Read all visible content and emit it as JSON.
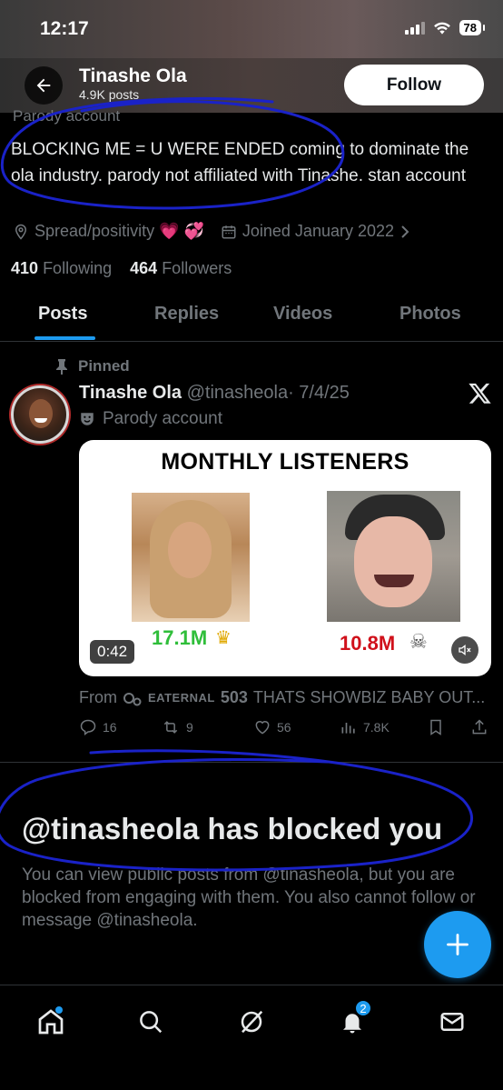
{
  "status_bar": {
    "time": "12:17",
    "battery": "78"
  },
  "header": {
    "name": "Tinashe Ola",
    "post_count": "4.9K posts",
    "follow_label": "Follow"
  },
  "profile": {
    "cut_label": "Parody account",
    "bio": "BLOCKING ME = U WERE ENDED coming to dominate the ola industry. parody not affiliated with Tinashe. stan account",
    "location": "Spread/positivity 💗 💞",
    "joined": "Joined January 2022",
    "following_count": "410",
    "following_label": "Following",
    "followers_count": "464",
    "followers_label": "Followers"
  },
  "tabs": [
    {
      "label": "Posts",
      "active": true
    },
    {
      "label": "Replies",
      "active": false
    },
    {
      "label": "Videos",
      "active": false
    },
    {
      "label": "Photos",
      "active": false
    }
  ],
  "post": {
    "pinned_label": "Pinned",
    "author": "Tinashe Ola",
    "handle": "@tinasheola",
    "date": "· 7/4/25",
    "tag": "Parody account",
    "media": {
      "title": "MONTHLY LISTENERS",
      "stat_left": "17.1M",
      "stat_right": "10.8M",
      "duration": "0:42"
    },
    "from_prefix": "From",
    "from_source": "EATERNAL",
    "from_number": "503",
    "from_text": "THATS SHOWBIZ BABY OUT...",
    "replies": "16",
    "reposts": "9",
    "likes": "56",
    "views": "7.8K"
  },
  "blocked": {
    "title": "@tinasheola has blocked you",
    "body": "You can view public posts from @tinasheola, but you are blocked from engaging with them. You also cannot follow or message @tinasheola."
  },
  "nav": {
    "notifications_badge": "2"
  },
  "colors": {
    "accent": "#1d9bf0",
    "muted": "#71767b",
    "text": "#e7e9ea",
    "ink": "#1a22c8"
  }
}
